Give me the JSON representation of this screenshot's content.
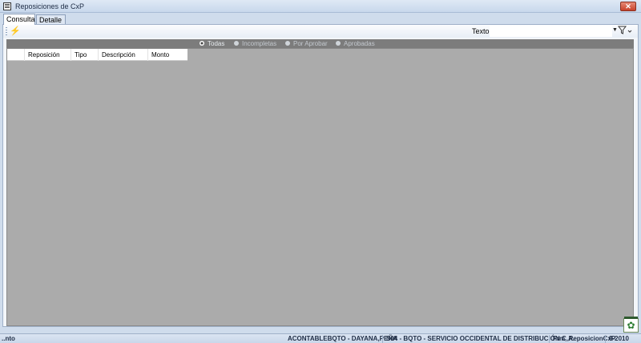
{
  "window": {
    "title": "Reposiciones de CxP",
    "close_label": "✕"
  },
  "tabs": [
    {
      "label": "Consulta",
      "active": true
    },
    {
      "label": "Detalle",
      "active": false
    }
  ],
  "toolbar": {
    "refresh_icon": "lightning-icon",
    "search_label": "Texto:",
    "search_value": "",
    "filter_icon": "filter-icon"
  },
  "filter_options": [
    {
      "label": "Todas",
      "selected": true
    },
    {
      "label": "Incompletas",
      "selected": false
    },
    {
      "label": "Por Aprobar",
      "selected": false
    },
    {
      "label": "Aprobadas",
      "selected": false
    }
  ],
  "grid": {
    "columns": [
      "Reposición",
      "Tipo",
      "Descripción",
      "Monto"
    ],
    "rows": []
  },
  "statusbar": {
    "left": "..nto",
    "user": "ACONTABLEBQTO - DAYANA,PEÑA",
    "company": "S04 - BQTO - SERVICIO OCCIDENTAL DE DISTRIBUCIÓN C.A.",
    "form": "Frm_ReposicionCxP",
    "period": "9-2010"
  },
  "colors": {
    "grid_background": "#ababab",
    "radio_bar": "#7c7c7c",
    "titlebar": "#c8d8ec"
  }
}
